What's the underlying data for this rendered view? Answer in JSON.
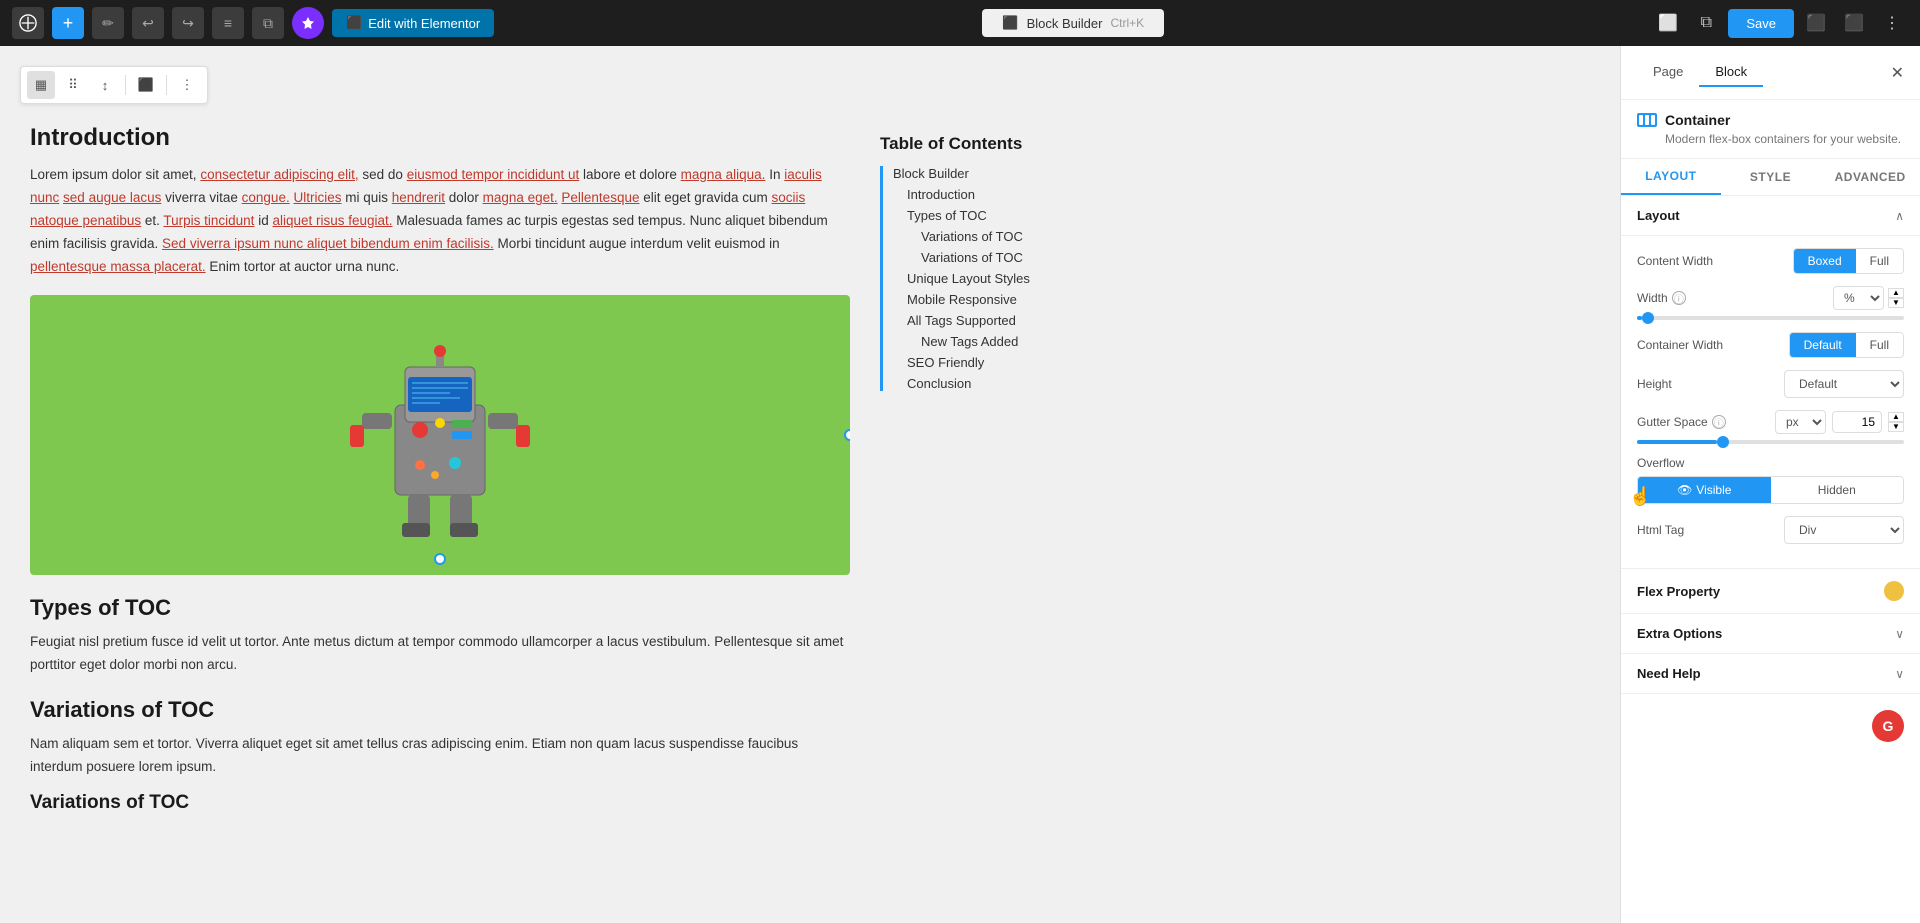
{
  "topbar": {
    "logo_label": "W",
    "plus_btn": "+",
    "edit_icon": "✏",
    "undo_icon": "↩",
    "redo_icon": "↪",
    "list_icon": "≡",
    "copy_icon": "⧉",
    "purple_icon": "❋",
    "elementor_btn": "Edit with Elementor",
    "page_title": "Block Builder",
    "shortcut": "Ctrl+K",
    "monitor_icon": "⬜",
    "external_icon": "⧉",
    "save_btn": "Save",
    "toggle_icon": "⬛",
    "dots_icon": "⋮"
  },
  "block_toolbar": {
    "btn1": "▦",
    "btn2": "⠿",
    "btn3": "↕",
    "btn4": "⬛",
    "btn5": "⋮"
  },
  "article": {
    "heading": "Introduction",
    "intro_text": "Lorem ipsum dolor sit amet, consectetur adipiscing elit, sed do eiusmod tempor incididunt ut labore et dolore magna aliqua. In iaculis nunc sed augue lacus viverra vitae congue. Ultricies mi quis hendrerit dolor magna eget. Pellentesque elit eget gravida cum sociis natoque penatibus et. Turpis tincidunt id aliquet risus feugiat. Malesuada fames ac turpis egestas sed tempus. Nunc aliquet bibendum enim facilisis gravida. Sed viverra ipsum nunc aliquet bibendum enim facilisis. Morbi tincidunt augue interdum velit euismod in pellentesque massa placerat. Enim tortor at auctor urna nunc.",
    "section2_heading": "Types of TOC",
    "section2_text": "Feugiat nisl pretium fusce id velit ut tortor. Ante metus dictum at tempor commodo ullamcorper a lacus vestibulum. Pellentesque sit amet porttitor eget dolor morbi non arcu.",
    "section3_heading": "Variations of TOC",
    "section3_text": "Nam aliquam sem et tortor. Viverra aliquet eget sit amet tellus cras adipiscing enim. Etiam non quam lacus suspendisse faucibus interdum posuere lorem ipsum.",
    "section4_heading": "Variations of TOC"
  },
  "toc": {
    "title": "Table of Contents",
    "items": [
      {
        "label": "Block Builder",
        "level": 0
      },
      {
        "label": "Introduction",
        "level": 1
      },
      {
        "label": "Types of TOC",
        "level": 1
      },
      {
        "label": "Variations of TOC",
        "level": 2
      },
      {
        "label": "Variations of TOC",
        "level": 2
      },
      {
        "label": "Unique Layout Styles",
        "level": 1
      },
      {
        "label": "Mobile Responsive",
        "level": 1
      },
      {
        "label": "All Tags Supported",
        "level": 1
      },
      {
        "label": "New Tags Added",
        "level": 2
      },
      {
        "label": "SEO Friendly",
        "level": 1
      },
      {
        "label": "Conclusion",
        "level": 1
      }
    ]
  },
  "panel": {
    "page_tab": "Page",
    "block_tab": "Block",
    "container_title": "Container",
    "container_desc": "Modern flex-box containers for your website.",
    "layout_tab": "LAYOUT",
    "style_tab": "STYLE",
    "advanced_tab": "ADVANCED",
    "layout_section": "Layout",
    "content_width_label": "Content Width",
    "boxed_btn": "Boxed",
    "full_btn": "Full",
    "width_label": "Width",
    "width_unit": "%",
    "width_value": "",
    "container_width_label": "Container Width",
    "default_btn": "Default",
    "full2_btn": "Full",
    "height_label": "Height",
    "height_value": "Default",
    "gutter_label": "Gutter Space",
    "gutter_unit": "px",
    "gutter_value": "15",
    "overflow_label": "Overflow",
    "visible_btn": "Visible",
    "hidden_btn": "Hidden",
    "html_tag_label": "Html Tag",
    "html_tag_value": "Div",
    "flex_property_label": "Flex Property",
    "extra_options_label": "Extra Options",
    "need_help_label": "Need Help"
  }
}
